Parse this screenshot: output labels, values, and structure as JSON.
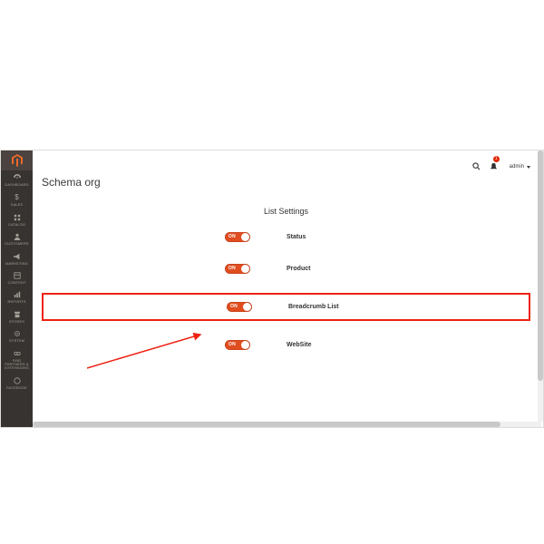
{
  "header": {
    "title": "Schema org",
    "admin_label": "admin",
    "notif_count": "1"
  },
  "sidebar": {
    "items": [
      {
        "label": "DASHBOARD"
      },
      {
        "label": "SALES"
      },
      {
        "label": "CATALOG"
      },
      {
        "label": "CUSTOMERS"
      },
      {
        "label": "MARKETING"
      },
      {
        "label": "CONTENT"
      },
      {
        "label": "REPORTS"
      },
      {
        "label": "STORES"
      },
      {
        "label": "SYSTEM"
      },
      {
        "label": "FIND PARTNERS & EXTENSIONS"
      },
      {
        "label": "FACEBOOK"
      }
    ]
  },
  "panel": {
    "title": "List Settings",
    "toggle_on": "ON",
    "rows": [
      {
        "label": "Status"
      },
      {
        "label": "Product"
      },
      {
        "label": "Breadcrumb List"
      },
      {
        "label": "WebSite"
      }
    ]
  }
}
